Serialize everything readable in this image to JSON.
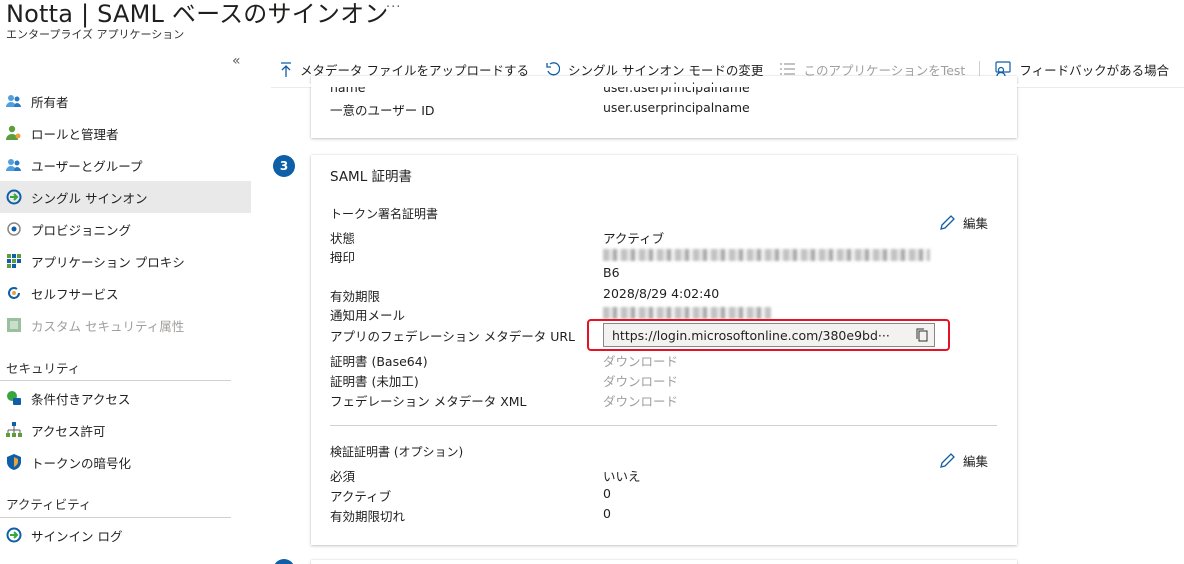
{
  "header": {
    "title": "Notta | SAML ベースのサインオン",
    "more": "···",
    "subtitle": "エンタープライズ アプリケーション"
  },
  "sidebar": {
    "collapse": "«",
    "items": [
      {
        "label": "所有者",
        "icon": "owners-icon"
      },
      {
        "label": "ロールと管理者",
        "icon": "roles-icon"
      },
      {
        "label": "ユーザーとグループ",
        "icon": "users-groups-icon"
      },
      {
        "label": "シングル サインオン",
        "icon": "sso-icon",
        "active": true
      },
      {
        "label": "プロビジョニング",
        "icon": "provisioning-icon"
      },
      {
        "label": "アプリケーション プロキシ",
        "icon": "app-proxy-icon"
      },
      {
        "label": "セルフサービス",
        "icon": "self-service-icon"
      },
      {
        "label": "カスタム セキュリティ属性",
        "icon": "custom-attr-icon",
        "disabled": true
      }
    ],
    "security_heading": "セキュリティ",
    "security_items": [
      {
        "label": "条件付きアクセス",
        "icon": "conditional-access-icon"
      },
      {
        "label": "アクセス許可",
        "icon": "permissions-icon"
      },
      {
        "label": "トークンの暗号化",
        "icon": "token-encryption-icon"
      }
    ],
    "activity_heading": "アクティビティ",
    "activity_items": [
      {
        "label": "サインイン ログ",
        "icon": "sign-in-logs-icon"
      }
    ]
  },
  "toolbar": {
    "upload": "メタデータ ファイルをアップロードする",
    "change_mode": "シングル サインオン モードの変更",
    "test": "このアプリケーションをTest",
    "feedback": "フィードバックがある場合"
  },
  "attributes_card": {
    "rows": [
      {
        "label": "name",
        "value": "user.userprincipalname"
      },
      {
        "label": "一意のユーザー ID",
        "value": "user.userprincipalname"
      }
    ]
  },
  "saml_card": {
    "step": "3",
    "title": "SAML 証明書",
    "token_section": "トークン署名証明書",
    "edit": "編集",
    "status_label": "状態",
    "status_value": "アクティブ",
    "thumbprint_label": "拇印",
    "thumbprint_tail": "B6",
    "expiry_label": "有効期限",
    "expiry_value": "2028/8/29 4:02:40",
    "email_label": "通知用メール",
    "metadata_url_label": "アプリのフェデレーション メタデータ URL",
    "metadata_url": "https://login.microsoftonline.com/380e9bd···",
    "cert_base64_label": "証明書 (Base64)",
    "cert_raw_label": "証明書 (未加工)",
    "fed_xml_label": "フェデレーション メタデータ XML",
    "download": "ダウンロード",
    "verify_section": "検証証明書 (オプション)",
    "required_label": "必須",
    "required_value": "いいえ",
    "active_label": "アクティブ",
    "active_value": "0",
    "expired_label": "有効期限切れ",
    "expired_value": "0"
  },
  "colors": {
    "accent": "#0f5ea8",
    "highlight": "#e81123",
    "disabled": "#a19f9d"
  }
}
